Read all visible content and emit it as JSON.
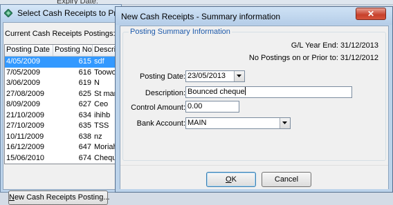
{
  "background_window": {
    "top_strip_text": "Expiry Date:",
    "title": "Select Cash Receipts to Process",
    "caption": "Current Cash Receipts Postings:-",
    "columns": [
      "Posting Date",
      "Posting No",
      "Description"
    ],
    "rows": [
      {
        "date": "4/05/2009",
        "no": "615",
        "desc": "sdf",
        "selected": true
      },
      {
        "date": "7/05/2009",
        "no": "616",
        "desc": "Toowoomba"
      },
      {
        "date": "3/06/2009",
        "no": "619",
        "desc": "N"
      },
      {
        "date": "27/08/2009",
        "no": "625",
        "desc": "St mary"
      },
      {
        "date": "8/09/2009",
        "no": "627",
        "desc": "Ceo"
      },
      {
        "date": "21/10/2009",
        "no": "634",
        "desc": "ihihb"
      },
      {
        "date": "27/10/2009",
        "no": "635",
        "desc": "TSS"
      },
      {
        "date": "10/11/2009",
        "no": "638",
        "desc": "nz"
      },
      {
        "date": "16/12/2009",
        "no": "647",
        "desc": "Moriah"
      },
      {
        "date": "15/06/2010",
        "no": "674",
        "desc": "Cheque"
      }
    ],
    "new_button_label_pre": "",
    "new_button_label_u": "N",
    "new_button_label_post": "ew Cash Receipts Posting..."
  },
  "dialog": {
    "title": "New Cash Receipts - Summary information",
    "close_icon": "close-x",
    "group_legend": "Posting Summary Information",
    "gl_year_end": "G/L Year End: 31/12/2013",
    "no_postings": "No Postings on or Prior to: 31/12/2012",
    "posting_date_label": "Posting Date:",
    "posting_date_value": "23/05/2013",
    "description_label": "Description:",
    "description_value": "Bounced cheque",
    "control_amount_label": "Control Amount:",
    "control_amount_value": "0.00",
    "bank_account_label": "Bank Account:",
    "bank_account_value": "MAIN",
    "ok_label_u": "O",
    "ok_label_rest": "K",
    "cancel_label": "Cancel"
  },
  "colors": {
    "selection": "#3399ff",
    "legend_text": "#1d5aab",
    "close_button": "#c7402b"
  }
}
